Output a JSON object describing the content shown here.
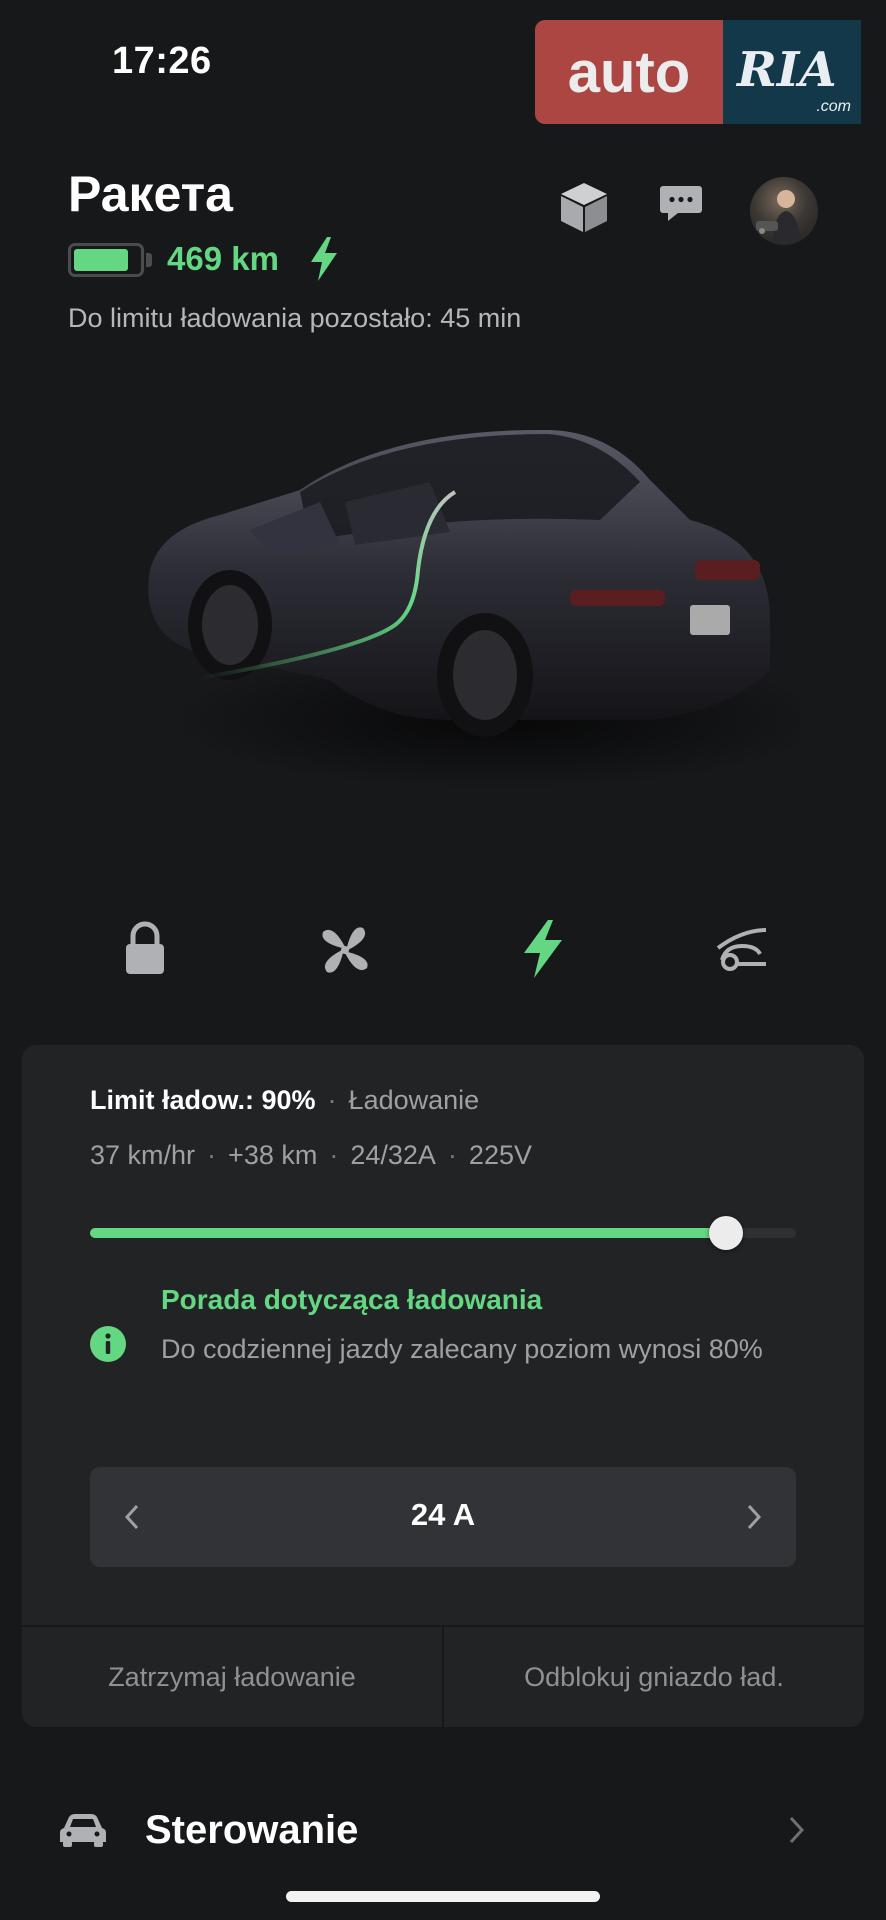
{
  "status_bar": {
    "time": "17:26"
  },
  "watermark": {
    "left": "auto",
    "right": "RIA",
    "suffix": ".com"
  },
  "header": {
    "car_name": "Ракета",
    "range": "469 km",
    "battery_level": 0.85,
    "remaining_text": "Do limitu ładowania pozostało: 45 min"
  },
  "charging": {
    "limit_label": "Limit ładow.: 90%",
    "state": "Ładowanie",
    "rate": "37 km/hr",
    "added": "+38 km",
    "current": "24/32A",
    "voltage": "225V",
    "slider_level": 0.9,
    "tip_title": "Porada dotycząca ładowania",
    "tip_body": "Do codziennej jazdy zalecany poziom wynosi 80%",
    "amps": "24 A",
    "stop_label": "Zatrzymaj ładowanie",
    "unlock_label": "Odblokuj gniazdo ład."
  },
  "controls": {
    "label": "Sterowanie"
  },
  "colors": {
    "accent": "#64d783",
    "background": "#17181a",
    "card": "#222325"
  },
  "icons": [
    "box-icon",
    "chat-icon",
    "avatar",
    "lock-icon",
    "fan-icon",
    "bolt-icon",
    "wiper-icon",
    "info-icon",
    "chevron-left-icon",
    "chevron-right-icon",
    "car-icon"
  ]
}
